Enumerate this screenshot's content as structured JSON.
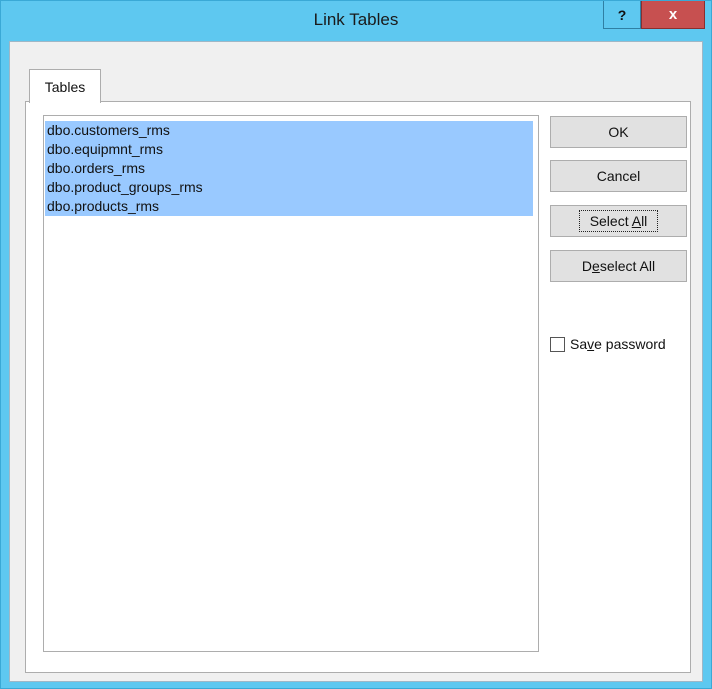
{
  "window": {
    "title": "Link Tables",
    "help_glyph": "?",
    "close_glyph": "x"
  },
  "tabs": [
    {
      "label": "Tables"
    }
  ],
  "tables_list": {
    "items": [
      "dbo.customers_rms",
      "dbo.equipmnt_rms",
      "dbo.orders_rms",
      "dbo.product_groups_rms",
      "dbo.products_rms"
    ],
    "selection_color": "#99c9ff"
  },
  "buttons": {
    "ok": "OK",
    "cancel": "Cancel",
    "select_all_prefix": "Select ",
    "select_all_mnemonic": "A",
    "select_all_suffix": "ll",
    "deselect_all_prefix": "D",
    "deselect_all_mnemonic": "e",
    "deselect_all_suffix": "select All"
  },
  "save_password": {
    "prefix": "Sa",
    "mnemonic": "v",
    "suffix": "e password",
    "checked": false
  },
  "colors": {
    "titlebar": "#5ec8f0",
    "close_button": "#c75050",
    "dialog_background": "#f0f0f0"
  }
}
